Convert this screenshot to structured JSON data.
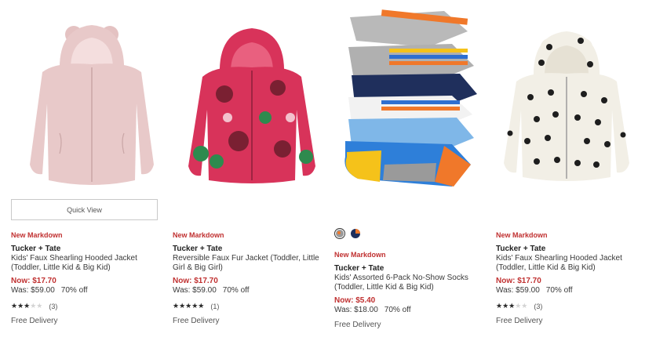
{
  "products": [
    {
      "quick_view": "Quick View",
      "badge": "New Markdown",
      "brand": "Tucker + Tate",
      "title": "Kids' Faux Shearling Hooded Jacket (Toddler, Little Kid & Big Kid)",
      "now_price": "Now: $17.70",
      "was_price": "Was: $59.00",
      "discount": "70% off",
      "rating": 3,
      "rating_max": 5,
      "review_count": "(3)",
      "delivery": "Free Delivery",
      "image_icon": "pink-faux-shearling-jacket",
      "colors": {
        "main": "#e8c9c9",
        "shade": "#d4aeae"
      }
    },
    {
      "badge": "New Markdown",
      "brand": "Tucker + Tate",
      "title": "Reversible Faux Fur Jacket (Toddler, Little Girl & Big Girl)",
      "now_price": "Now: $17.70",
      "was_price": "Was: $59.00",
      "discount": "70% off",
      "rating": 5,
      "rating_max": 5,
      "review_count": "(1)",
      "delivery": "Free Delivery",
      "image_icon": "floral-faux-fur-jacket",
      "colors": {
        "main": "#d8335a",
        "flower": "#7a2032",
        "leaf": "#2e8a4e"
      }
    },
    {
      "badge": "New Markdown",
      "brand": "Tucker + Tate",
      "title": "Kids' Assorted 6-Pack No-Show Socks (Toddler, Little Kid & Big Kid)",
      "now_price": "Now: $5.40",
      "was_price": "Was: $18.00",
      "discount": "70% off",
      "delivery": "Free Delivery",
      "image_icon": "assorted-socks-pack",
      "swatches": [
        "grey-multi-swatch",
        "navy-orange-swatch"
      ]
    },
    {
      "badge": "New Markdown",
      "brand": "Tucker + Tate",
      "title": "Kids' Faux Shearling Hooded Jacket (Toddler, Little Kid & Big Kid)",
      "now_price": "Now: $17.70",
      "was_price": "Was: $59.00",
      "discount": "70% off",
      "rating": 3,
      "rating_max": 5,
      "review_count": "(3)",
      "delivery": "Free Delivery",
      "image_icon": "polka-dot-faux-shearling-jacket",
      "colors": {
        "main": "#f2efe6",
        "dots": "#1e1e1e"
      }
    }
  ],
  "star_glyphs": "★★★★★"
}
